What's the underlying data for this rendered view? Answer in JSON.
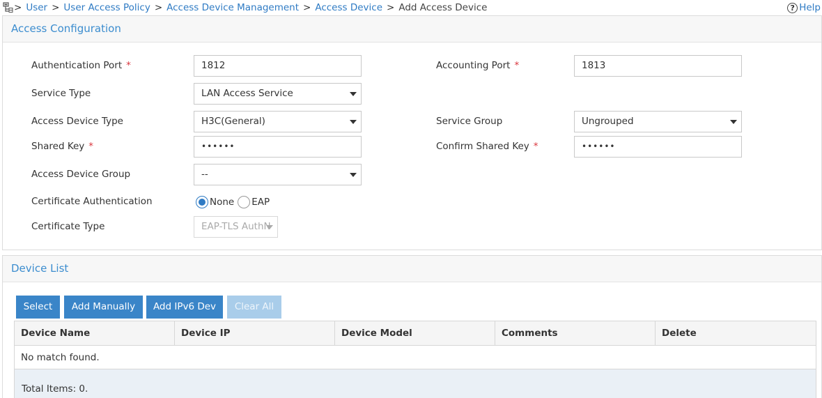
{
  "breadcrumb": {
    "items": [
      "User",
      "User Access Policy",
      "Access Device Management",
      "Access Device"
    ],
    "current": "Add Access Device",
    "separator": ">",
    "help_label": "Help"
  },
  "access_config": {
    "title": "Access Configuration",
    "auth_port_label": "Authentication Port",
    "auth_port_value": "1812",
    "acct_port_label": "Accounting Port",
    "acct_port_value": "1813",
    "service_type_label": "Service Type",
    "service_type_value": "LAN Access Service",
    "device_type_label": "Access Device Type",
    "device_type_value": "H3C(General)",
    "service_group_label": "Service Group",
    "service_group_value": "Ungrouped",
    "shared_key_label": "Shared Key",
    "shared_key_value": "••••••",
    "confirm_key_label": "Confirm Shared Key",
    "confirm_key_value": "••••••",
    "device_group_label": "Access Device Group",
    "device_group_value": "--",
    "cert_auth_label": "Certificate Authentication",
    "cert_auth_options": [
      "None",
      "EAP"
    ],
    "cert_auth_selected": "None",
    "cert_type_label": "Certificate Type",
    "cert_type_value": "EAP-TLS AuthN",
    "required_mark": "*"
  },
  "device_list": {
    "title": "Device List",
    "buttons": {
      "select": "Select",
      "add_manually": "Add Manually",
      "add_ipv6": "Add IPv6 Dev",
      "clear_all": "Clear All"
    },
    "columns": [
      "Device Name",
      "Device IP",
      "Device Model",
      "Comments",
      "Delete"
    ],
    "empty_text": "No match found.",
    "total_text": "Total Items: 0."
  },
  "colors": {
    "accent": "#3a85c8",
    "link": "#2f7bc4",
    "required": "#d9363e"
  }
}
